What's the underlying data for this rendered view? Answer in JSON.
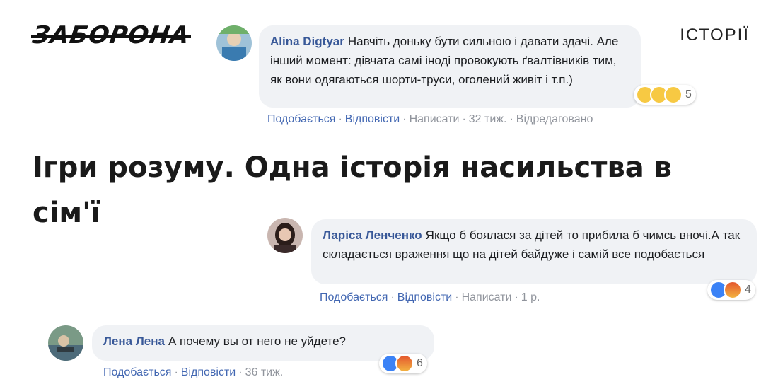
{
  "brand": {
    "logo": "ЗАБОРОНА",
    "section": "ІСТОРІЇ"
  },
  "headline": "Ігри розуму. Одна історія насильства в сім'ї",
  "comments": [
    {
      "author": "Alina Digtyar",
      "text": "Навчіть доньку бути сильною і давати здачі. Але інший момент: дівчата самі іноді провокують ґвалтівників тим, як вони одягаються шорти-труси, оголений живіт і т.п.)",
      "reaction_count": "5",
      "reactions": [
        "sad-emoji-icon",
        "wow-emoji-icon",
        "wow-emoji-icon"
      ],
      "actions": {
        "like": "Подобається",
        "reply": "Відповісти",
        "write": "Написати",
        "time": "32 тиж.",
        "edited": "Відредаговано"
      }
    },
    {
      "author": "Ларіса Ленченко",
      "text": "Якщо б боялася за дітей то прибила б чимсь вночі.А так складається враження що на дітей байдуже і самій все подобається",
      "reaction_count": "4",
      "reactions": [
        "like-icon",
        "angry-emoji-icon"
      ],
      "actions": {
        "like": "Подобається",
        "reply": "Відповісти",
        "write": "Написати",
        "time": "1 р."
      }
    },
    {
      "author": "Лена Лена",
      "text": "А почему вы от него не уйдете?",
      "reaction_count": "6",
      "reactions": [
        "like-icon",
        "angry-emoji-icon"
      ],
      "actions": {
        "like": "Подобається",
        "reply": "Відповісти",
        "time": "36 тиж."
      }
    }
  ],
  "colors": {
    "author": "#385898",
    "link": "#4267b2",
    "bubble": "#f0f2f5",
    "meta": "#90949c"
  }
}
